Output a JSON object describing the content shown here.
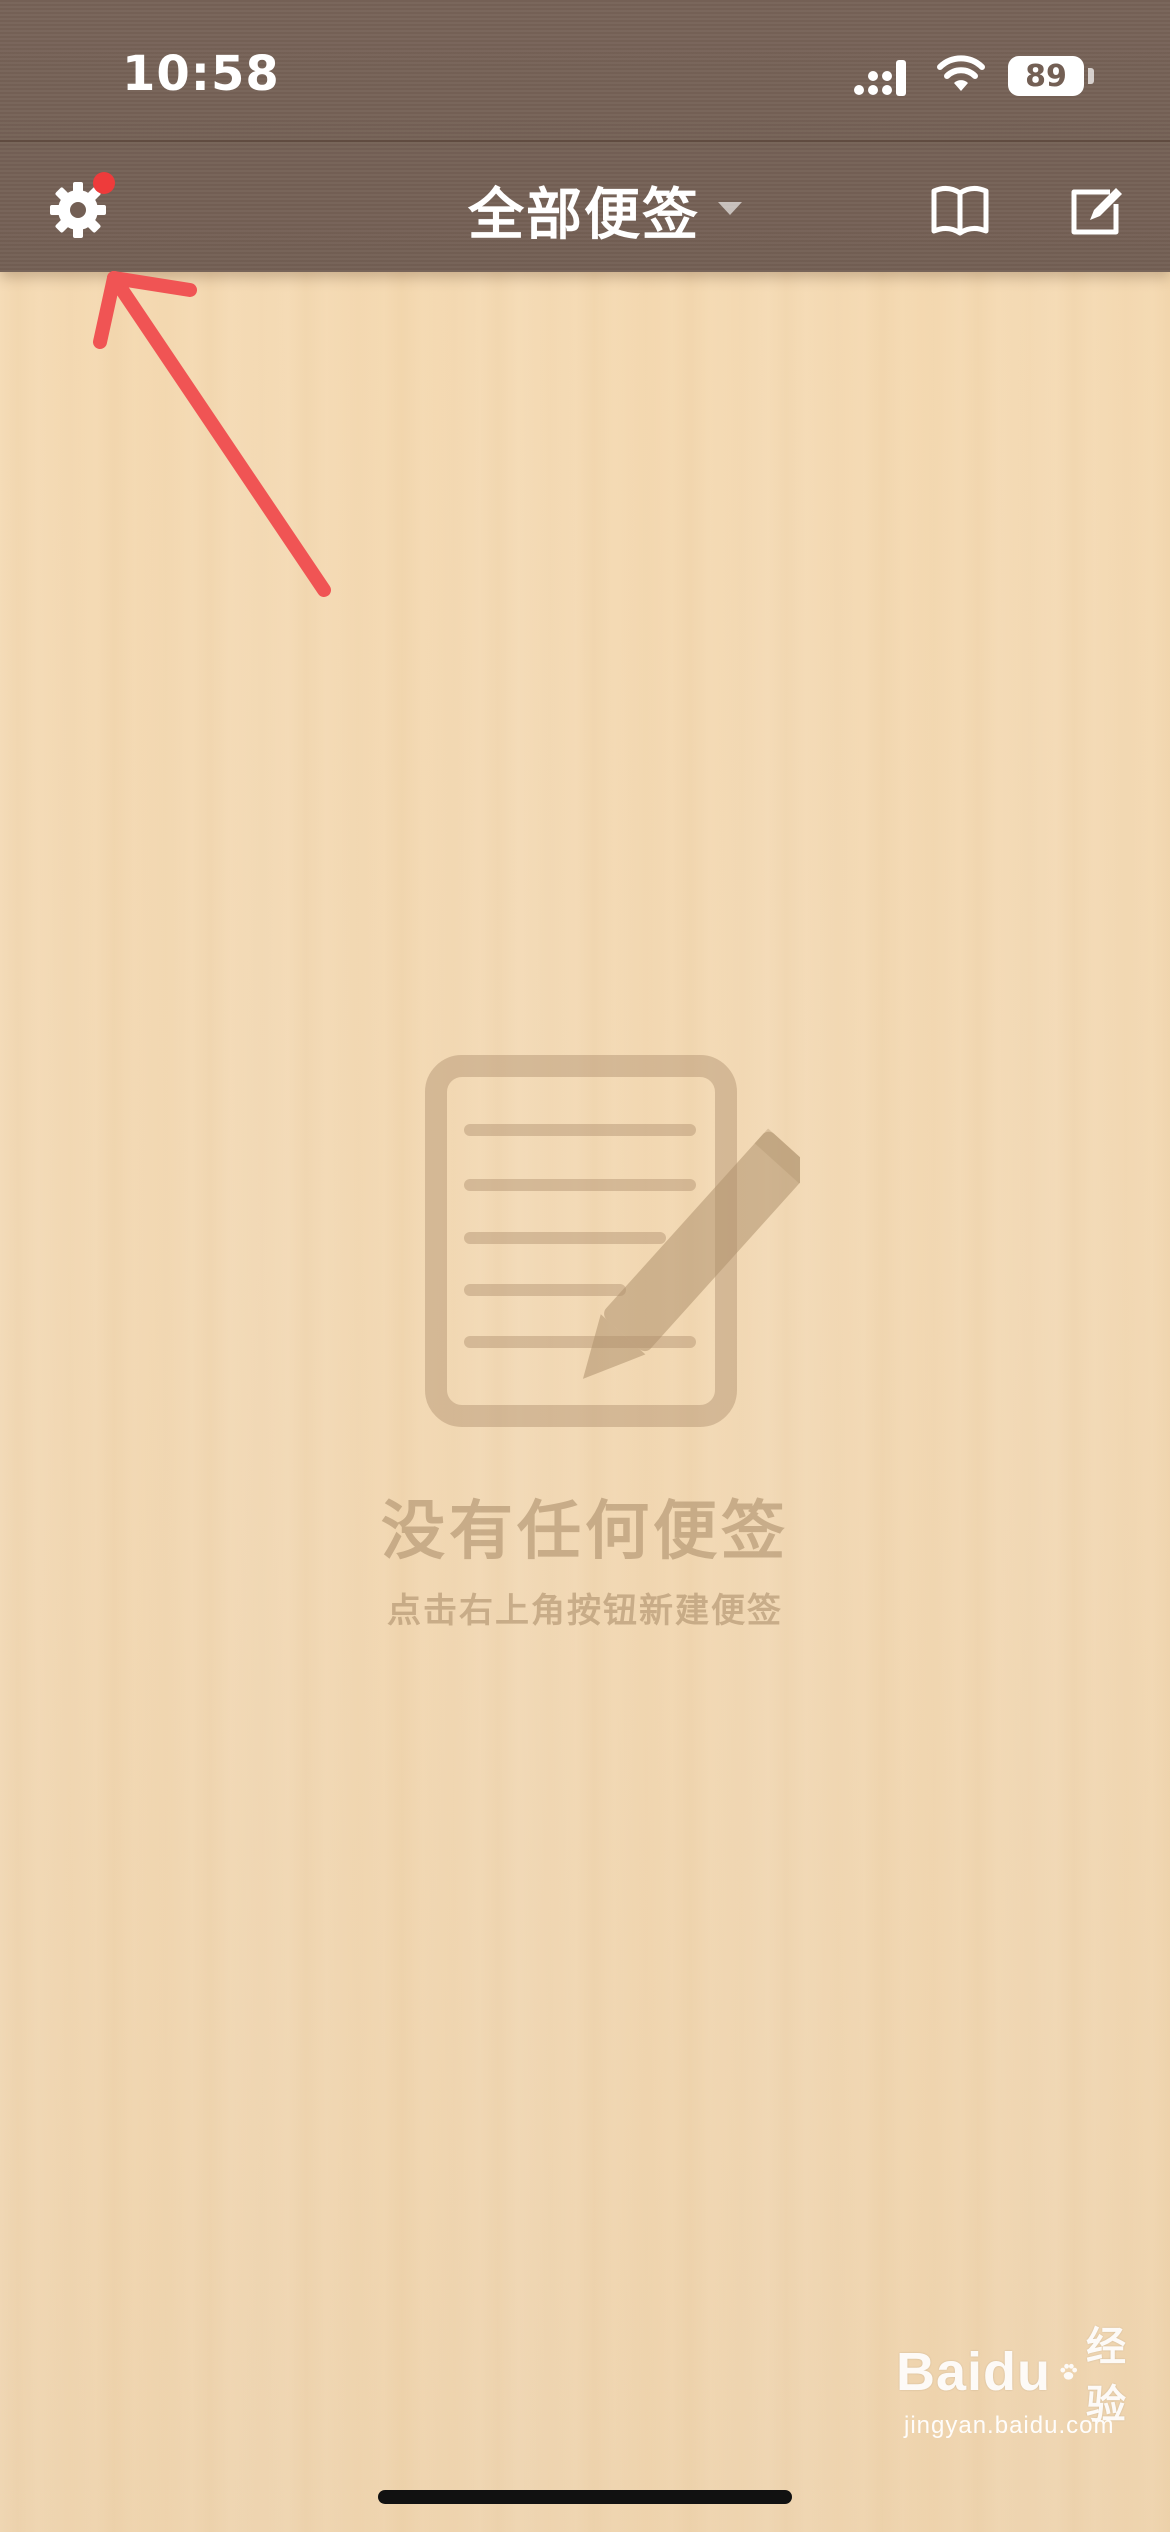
{
  "status_bar": {
    "time": "10:58",
    "battery_level": "89"
  },
  "nav": {
    "title": "全部便签",
    "settings_icon": "gear-icon",
    "has_notification": true,
    "book_icon": "book-icon",
    "compose_icon": "compose-icon"
  },
  "empty_state": {
    "icon": "note-edit-icon",
    "title": "没有任何便签",
    "subtitle": "点击右上角按钮新建便签"
  },
  "watermark": {
    "brand": "Baidu",
    "cn": "经验",
    "url": "jingyan.baidu.com"
  },
  "colors": {
    "bar": "#735f54",
    "accent_red": "#ee3b3b",
    "empty_text": "#b0916e"
  }
}
